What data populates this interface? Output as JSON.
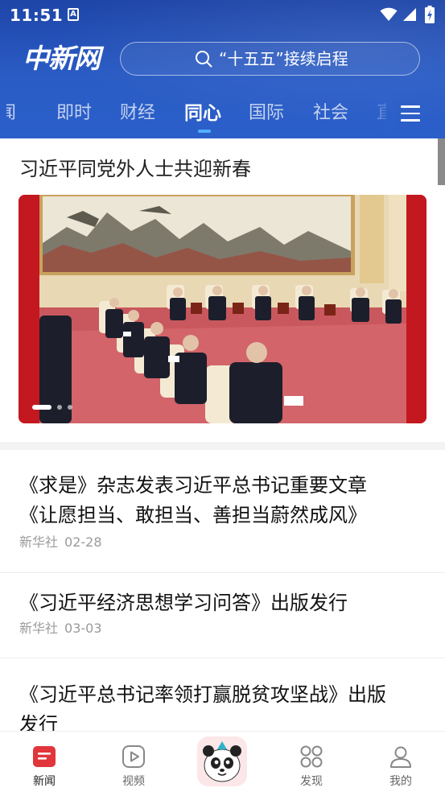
{
  "status_bar": {
    "time": "11:51",
    "notification_icon_letter": "A"
  },
  "header": {
    "logo": "中新网",
    "search": {
      "placeholder": "“十五五”接续启程"
    },
    "tabs": [
      {
        "label": "闻",
        "active": false
      },
      {
        "label": "即时",
        "active": false
      },
      {
        "label": "财经",
        "active": false
      },
      {
        "label": "同心",
        "active": true
      },
      {
        "label": "国际",
        "active": false
      },
      {
        "label": "社会",
        "active": false
      },
      {
        "label": "直",
        "active": false
      }
    ],
    "colors": {
      "accent": "#2b5fc9",
      "indicator": "#4fb0ff"
    }
  },
  "featured": {
    "title": "习近平同党外人士共迎新春",
    "carousel": {
      "slide_count": 3,
      "active_index": 0
    }
  },
  "news": [
    {
      "title_line1": "《求是》杂志发表习近平总书记重要文章",
      "title_line2": "《让愿担当、敢担当、善担当蔚然成风》",
      "source": "新华社",
      "date": "02-28"
    },
    {
      "title_line1": "《习近平经济思想学习问答》出版发行",
      "source": "新华社",
      "date": "03-03"
    },
    {
      "title_line1": "《习近平总书记率领打赢脱贫攻坚战》出版",
      "title_line2": "发行"
    }
  ],
  "bottom_nav": [
    {
      "label": "新闻",
      "icon": "news-icon",
      "active": true
    },
    {
      "label": "视频",
      "icon": "video-play-icon",
      "active": false
    },
    {
      "label": "",
      "icon": "panda-mascot-icon",
      "active": false
    },
    {
      "label": "发现",
      "icon": "discover-grid-icon",
      "active": false
    },
    {
      "label": "我的",
      "icon": "user-profile-icon",
      "active": false
    }
  ]
}
